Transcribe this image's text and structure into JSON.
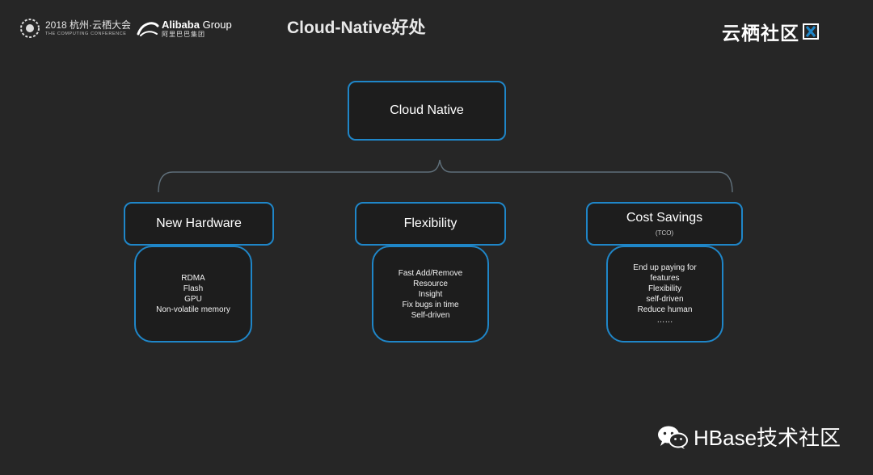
{
  "header": {
    "conference": {
      "main": "2018 杭州·云栖大会",
      "sub": "THE COMPUTING CONFERENCE"
    },
    "alibaba": {
      "brand": "Alibaba",
      "group": "Group",
      "chinese": "阿里巴巴集团"
    },
    "title": "Cloud-Native好处",
    "community_logo": "云栖社区"
  },
  "diagram": {
    "root": "Cloud Native",
    "branches": [
      {
        "title": "New Hardware",
        "note": "",
        "items": [
          "RDMA",
          "Flash",
          "GPU",
          "Non-volatile memory"
        ]
      },
      {
        "title": "Flexibility",
        "note": "",
        "items": [
          "Fast Add/Remove",
          "Resource",
          "Insight",
          "Fix bugs in time",
          "Self-driven"
        ]
      },
      {
        "title": "Cost Savings",
        "note": "(TCO)",
        "items": [
          "End up paying for",
          "features",
          "Flexibility",
          "self-driven",
          "Reduce human",
          "……"
        ]
      }
    ]
  },
  "footer": {
    "icon": "wechat-icon",
    "text": "HBase技术社区"
  },
  "colors": {
    "background": "#262626",
    "accent": "#1f86c8",
    "text": "#ffffff"
  }
}
